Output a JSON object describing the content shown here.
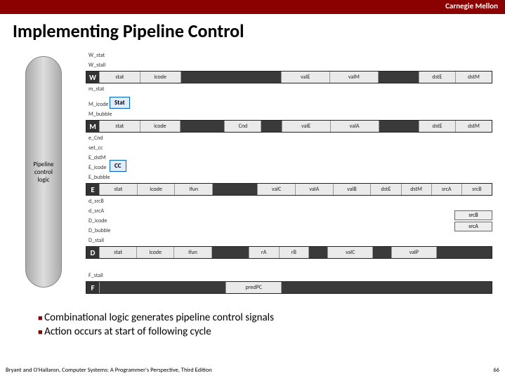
{
  "header": {
    "brand": "Carnegie Mellon"
  },
  "title": "Implementing Pipeline Control",
  "control_label": "Pipeline control logic",
  "stat_box": "Stat",
  "cc_box": "CC",
  "srcA": "srcA",
  "srcB": "srcB",
  "signals": {
    "w_stat": "W_stat",
    "w_stall": "W_stall",
    "m_stat": "m_stat",
    "m_icode": "M_icode",
    "m_bubble": "M_bubble",
    "e_cnd": "e_Cnd",
    "set_cc": "set_cc",
    "e_dstm": "E_dstM",
    "e_icode": "E_icode",
    "e_bubble": "E_bubble",
    "d_srcb": "d_srcB",
    "d_srca": "d_srcA",
    "d_icode": "D_icode",
    "d_bubble": "D_bubble",
    "d_stall": "D_stall",
    "f_stall": "F_stall"
  },
  "rows": {
    "W": {
      "letter": "W",
      "cells": [
        "stat",
        "icode",
        "",
        "valE",
        "valM",
        "",
        "dstE",
        "dstM"
      ]
    },
    "M": {
      "letter": "M",
      "cells": [
        "stat",
        "icode",
        "Cnd",
        "valE",
        "valA",
        "",
        "dstE",
        "dstM"
      ]
    },
    "E": {
      "letter": "E",
      "cells": [
        "stat",
        "icode",
        "ifun",
        "valC",
        "valA",
        "valB",
        "dstE",
        "dstM",
        "srcA",
        "srcB"
      ]
    },
    "D": {
      "letter": "D",
      "cells": [
        "stat",
        "icode",
        "ifun",
        "rA",
        "rB",
        "valC",
        "valP",
        ""
      ]
    },
    "F": {
      "letter": "F",
      "cells": [
        "",
        "",
        "predPC",
        "",
        "",
        "",
        "",
        ""
      ]
    }
  },
  "bullets": [
    "Combinational logic generates pipeline control signals",
    "Action occurs at start of following cycle"
  ],
  "footer": {
    "credit": "Bryant and O'Hallaron, Computer Systems: A Programmer's Perspective, Third Edition",
    "page": "66"
  }
}
